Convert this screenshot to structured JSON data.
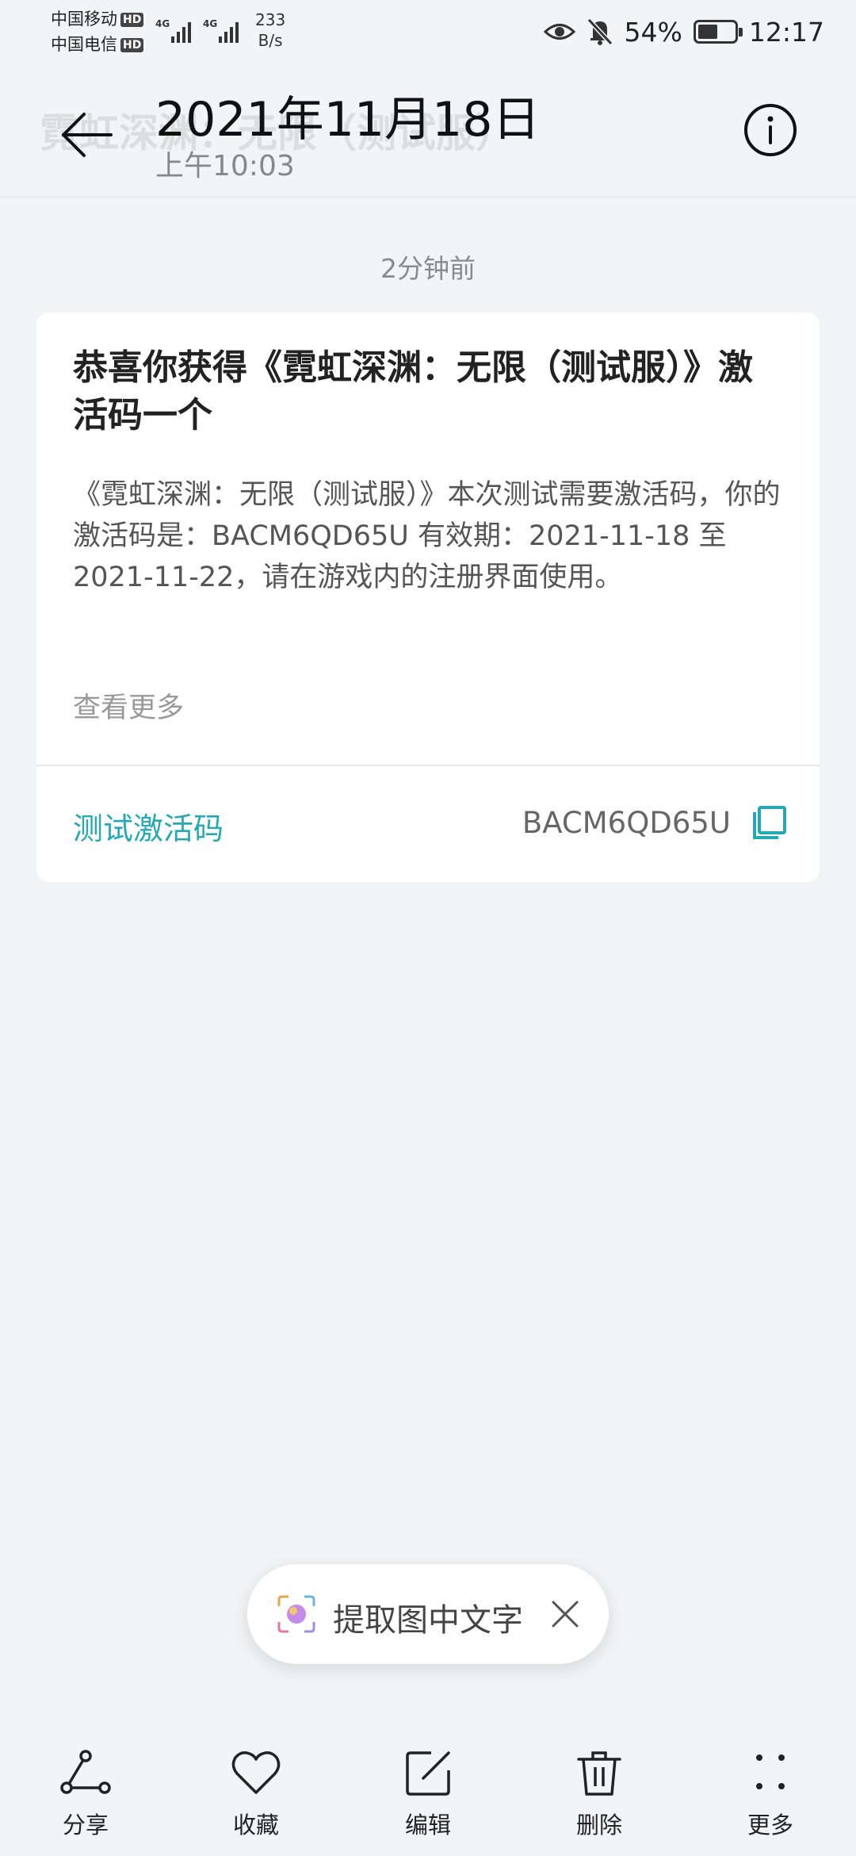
{
  "status_bar": {
    "carrier1": "中国移动",
    "carrier2": "中国电信",
    "hd_badge": "HD",
    "net_type": "4G",
    "net_speed_value": "233",
    "net_speed_unit": "B/s",
    "battery_percent": "54%",
    "battery_level": 0.54,
    "time": "12:17",
    "icons": [
      "eye-icon",
      "bell-mute-icon",
      "battery-icon",
      "signal-icon"
    ]
  },
  "header": {
    "ghost_title": "霓虹深渊：无限（测试服）",
    "date_title": "2021年11月18日",
    "time_subtitle": "上午10:03"
  },
  "relative_time": "2分钟前",
  "card": {
    "title": "恭喜你获得《霓虹深渊：无限（测试服）》激活码一个",
    "body": "《霓虹深渊：无限（测试服）》本次测试需要激活码，你的激活码是：BACM6QD65U 有效期：2021-11-18 至 2021-11-22，请在游戏内的注册界面使用。",
    "view_more": "查看更多",
    "code_label": "测试激活码",
    "code_value": "BACM6QD65U"
  },
  "pill": {
    "label": "提取图中文字"
  },
  "toolbar": {
    "items": [
      {
        "label": "分享",
        "icon": "share-icon"
      },
      {
        "label": "收藏",
        "icon": "heart-icon"
      },
      {
        "label": "编辑",
        "icon": "edit-icon"
      },
      {
        "label": "删除",
        "icon": "trash-icon"
      },
      {
        "label": "更多",
        "icon": "more-icon"
      }
    ]
  },
  "colors": {
    "accent": "#25a9b5",
    "background": "#f3f4f6",
    "card": "#ffffff"
  }
}
